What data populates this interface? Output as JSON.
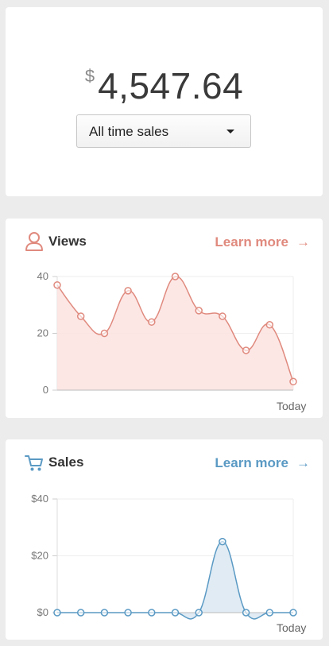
{
  "summary": {
    "currency_symbol": "$",
    "amount": "4,547.64",
    "period_select": {
      "selected": "All time sales"
    }
  },
  "views": {
    "title": "Views",
    "learn_more": "Learn more",
    "arrow": "→",
    "icon": "user-icon",
    "accent_color": "#e08a7e",
    "fill_color": "#fbe3e0",
    "y_axis": {
      "ticks": [
        "0",
        "20",
        "40"
      ],
      "min": 0,
      "max": 40
    },
    "x_end_label": "Today"
  },
  "sales": {
    "title": "Sales",
    "learn_more": "Learn more",
    "arrow": "→",
    "icon": "cart-icon",
    "accent_color": "#5b9ac4",
    "fill_color": "#dae8f2",
    "y_axis": {
      "ticks": [
        "$0",
        "$20",
        "$40"
      ],
      "min": 0,
      "max": 40
    },
    "x_end_label": "Today"
  },
  "chart_data": [
    {
      "type": "area",
      "title": "Views",
      "xlabel": "",
      "ylabel": "",
      "ylim": [
        0,
        40
      ],
      "x_end_label": "Today",
      "grid": true,
      "series": [
        {
          "values": [
            37,
            26,
            20,
            35,
            24,
            40,
            28,
            26,
            14,
            23,
            3
          ]
        }
      ]
    },
    {
      "type": "area",
      "title": "Sales",
      "xlabel": "",
      "ylabel": "",
      "ylim": [
        0,
        40
      ],
      "x_end_label": "Today",
      "grid": true,
      "series": [
        {
          "values": [
            0,
            0,
            0,
            0,
            0,
            0,
            0,
            25,
            0,
            0,
            0
          ]
        }
      ]
    }
  ]
}
